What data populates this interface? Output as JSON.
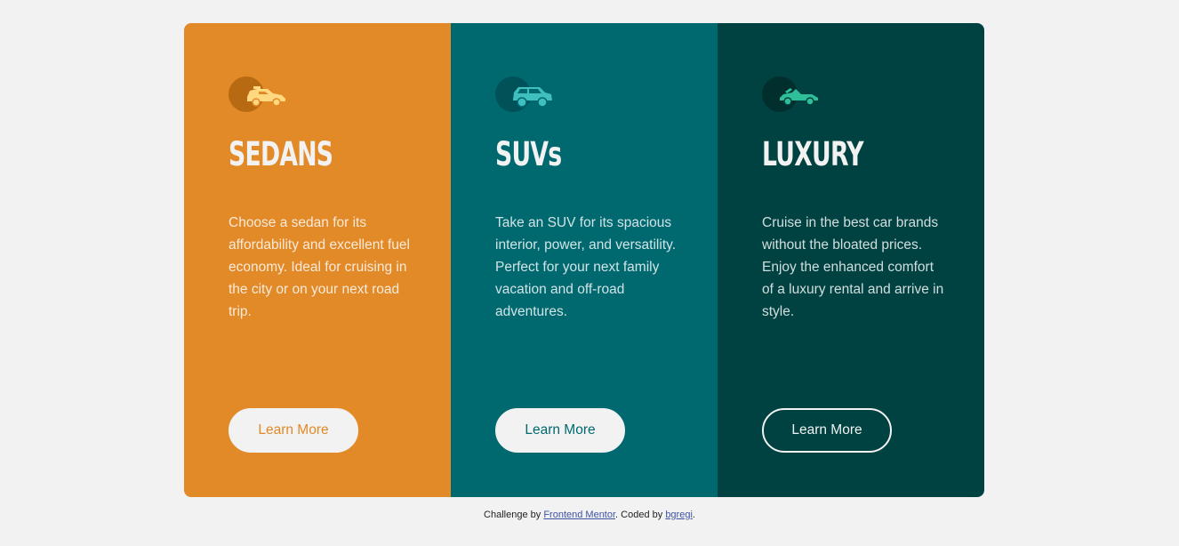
{
  "cards": [
    {
      "key": "sedans",
      "title": "SEDANS",
      "icon": "sedan-car-icon",
      "description": "Choose a sedan for its affordability and excellent fuel economy. Ideal for cruising in the city or on your next road trip.",
      "button_label": "Learn More",
      "background": "#e28928"
    },
    {
      "key": "suvs",
      "title": "SUVs",
      "icon": "suv-car-icon",
      "description": "Take an SUV for its spacious interior, power, and versatility. Perfect for your next family vacation and off-road adventures.",
      "button_label": "Learn More",
      "background": "#006970"
    },
    {
      "key": "luxury",
      "title": "LUXURY",
      "icon": "luxury-car-icon",
      "description": "Cruise in the best car brands without the bloated prices. Enjoy the enhanced comfort of a luxury rental and arrive in style.",
      "button_label": "Learn More",
      "background": "#004241"
    }
  ],
  "footer": {
    "prefix": "Challenge by ",
    "link1": "Frontend Mentor",
    "middle": ". Coded by ",
    "link2": "bgregi",
    "suffix": "."
  },
  "colors": {
    "page_background": "#f2f2f2",
    "button_background": "#f2f2f2",
    "link": "#3e52a3"
  }
}
